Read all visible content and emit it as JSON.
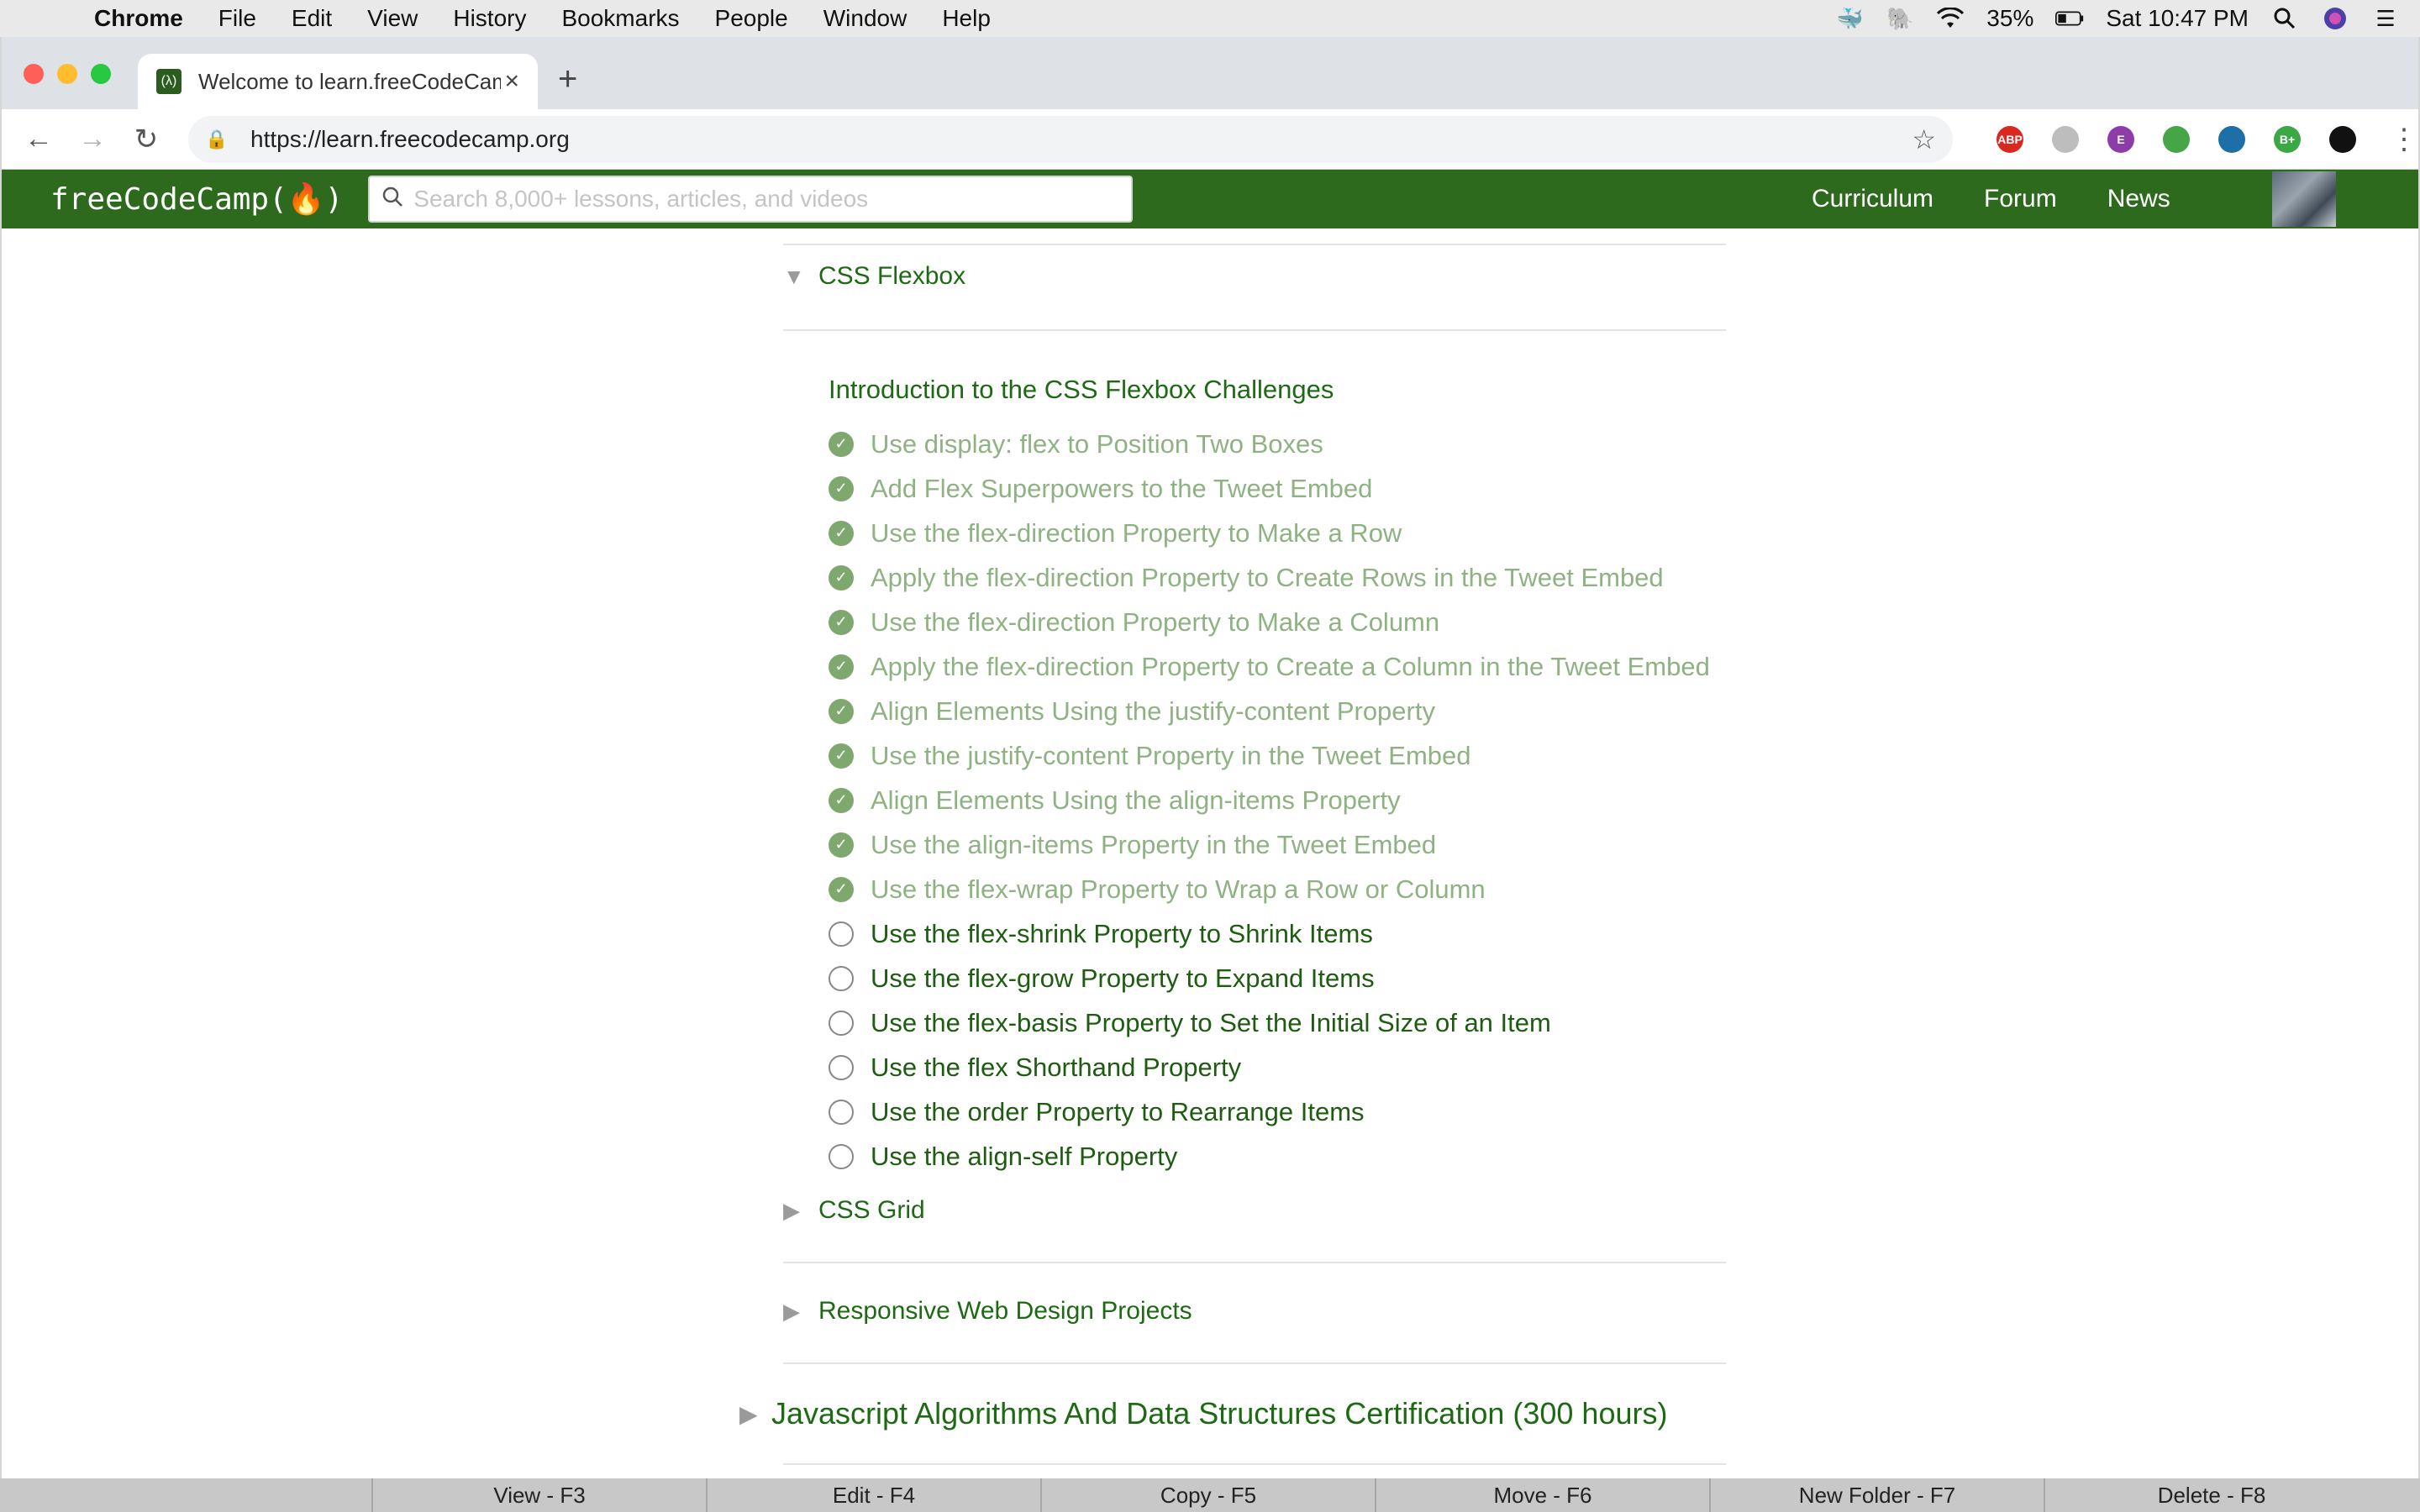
{
  "menubar": {
    "app_name": "Chrome",
    "items": [
      "File",
      "Edit",
      "View",
      "History",
      "Bookmarks",
      "People",
      "Window",
      "Help"
    ],
    "battery": "35%",
    "clock": "Sat 10:47 PM"
  },
  "browser": {
    "tab_title": "Welcome to learn.freeCodeCamp",
    "url": "https://learn.freecodecamp.org",
    "extensions": [
      {
        "label": "ABP",
        "color": "#d9281f"
      },
      {
        "label": "",
        "color": "#bdbdbd"
      },
      {
        "label": "E",
        "color": "#8e3da8"
      },
      {
        "label": "",
        "color": "#46a546"
      },
      {
        "label": "",
        "color": "#1c6fa7"
      },
      {
        "label": "B+",
        "color": "#3aa845"
      },
      {
        "label": "",
        "color": "#111111"
      }
    ]
  },
  "fcc": {
    "logo": "freeCodeCamp(🔥)",
    "search_placeholder": "Search 8,000+ lessons, articles, and videos",
    "nav": {
      "curriculum": "Curriculum",
      "forum": "Forum",
      "news": "News"
    }
  },
  "curriculum": {
    "flexbox_title": "CSS Flexbox",
    "intro": "Introduction to the CSS Flexbox Challenges",
    "challenges": [
      {
        "title": "Use display: flex to Position Two Boxes",
        "done": true
      },
      {
        "title": "Add Flex Superpowers to the Tweet Embed",
        "done": true
      },
      {
        "title": "Use the flex-direction Property to Make a Row",
        "done": true
      },
      {
        "title": "Apply the flex-direction Property to Create Rows in the Tweet Embed",
        "done": true
      },
      {
        "title": "Use the flex-direction Property to Make a Column",
        "done": true
      },
      {
        "title": "Apply the flex-direction Property to Create a Column in the Tweet Embed",
        "done": true
      },
      {
        "title": "Align Elements Using the justify-content Property",
        "done": true
      },
      {
        "title": "Use the justify-content Property in the Tweet Embed",
        "done": true
      },
      {
        "title": "Align Elements Using the align-items Property",
        "done": true
      },
      {
        "title": "Use the align-items Property in the Tweet Embed",
        "done": true
      },
      {
        "title": "Use the flex-wrap Property to Wrap a Row or Column",
        "done": true
      },
      {
        "title": "Use the flex-shrink Property to Shrink Items",
        "done": false
      },
      {
        "title": "Use the flex-grow Property to Expand Items",
        "done": false
      },
      {
        "title": "Use the flex-basis Property to Set the Initial Size of an Item",
        "done": false
      },
      {
        "title": "Use the flex Shorthand Property",
        "done": false
      },
      {
        "title": "Use the order Property to Rearrange Items",
        "done": false
      },
      {
        "title": "Use the align-self Property",
        "done": false
      }
    ],
    "grid_title": "CSS Grid",
    "projects_title": "Responsive Web Design Projects",
    "next_cert": "Javascript Algorithms And Data Structures Certification (300 hours)"
  },
  "function_bar": [
    "View - F3",
    "Edit - F4",
    "Copy - F5",
    "Move - F6",
    "New Folder - F7",
    "Delete - F8"
  ]
}
